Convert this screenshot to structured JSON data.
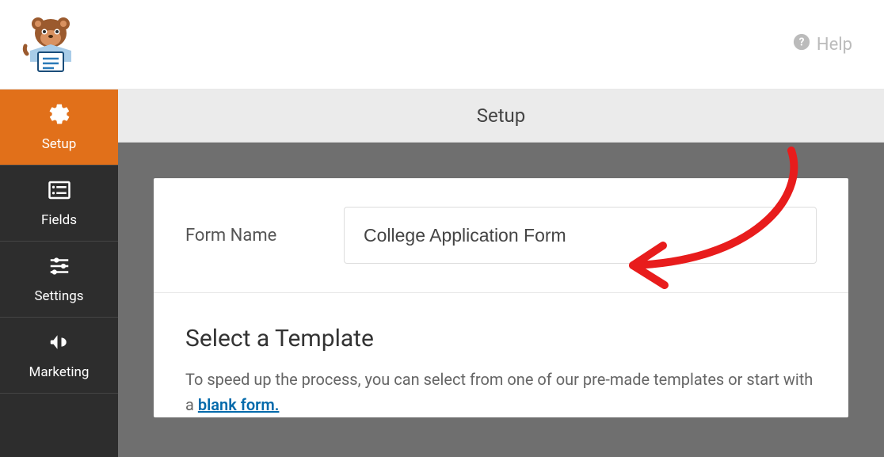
{
  "header": {
    "help_label": "Help"
  },
  "sidebar": {
    "items": [
      {
        "label": "Setup",
        "icon": "gear"
      },
      {
        "label": "Fields",
        "icon": "list"
      },
      {
        "label": "Settings",
        "icon": "sliders"
      },
      {
        "label": "Marketing",
        "icon": "megaphone"
      }
    ]
  },
  "content": {
    "tab_title": "Setup",
    "form_name_label": "Form Name",
    "form_name_value": "College Application Form",
    "template_heading": "Select a Template",
    "template_desc_prefix": "To speed up the process, you can select from one of our pre-made templates or start with a ",
    "template_desc_link": "blank form."
  }
}
